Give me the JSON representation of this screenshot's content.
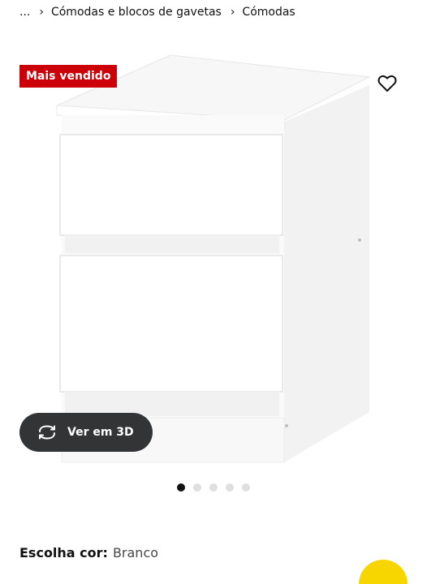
{
  "breadcrumb": {
    "items": [
      "...",
      "Cómodas e blocos de gavetas",
      "Cómodas"
    ],
    "separator": "›"
  },
  "product": {
    "badge": "Mais vendido",
    "badge_color": "#cc0008",
    "favorite_icon": "heart-outline-icon",
    "image_alt": "white-two-drawer-chest"
  },
  "viewer": {
    "button_label": "Ver em 3D",
    "button_icon": "rotate-3d-icon",
    "dots_count": 5,
    "active_dot": 0
  },
  "color_choice": {
    "label": "Escolha cor:",
    "value": "Branco"
  },
  "accent": "#f7d600"
}
